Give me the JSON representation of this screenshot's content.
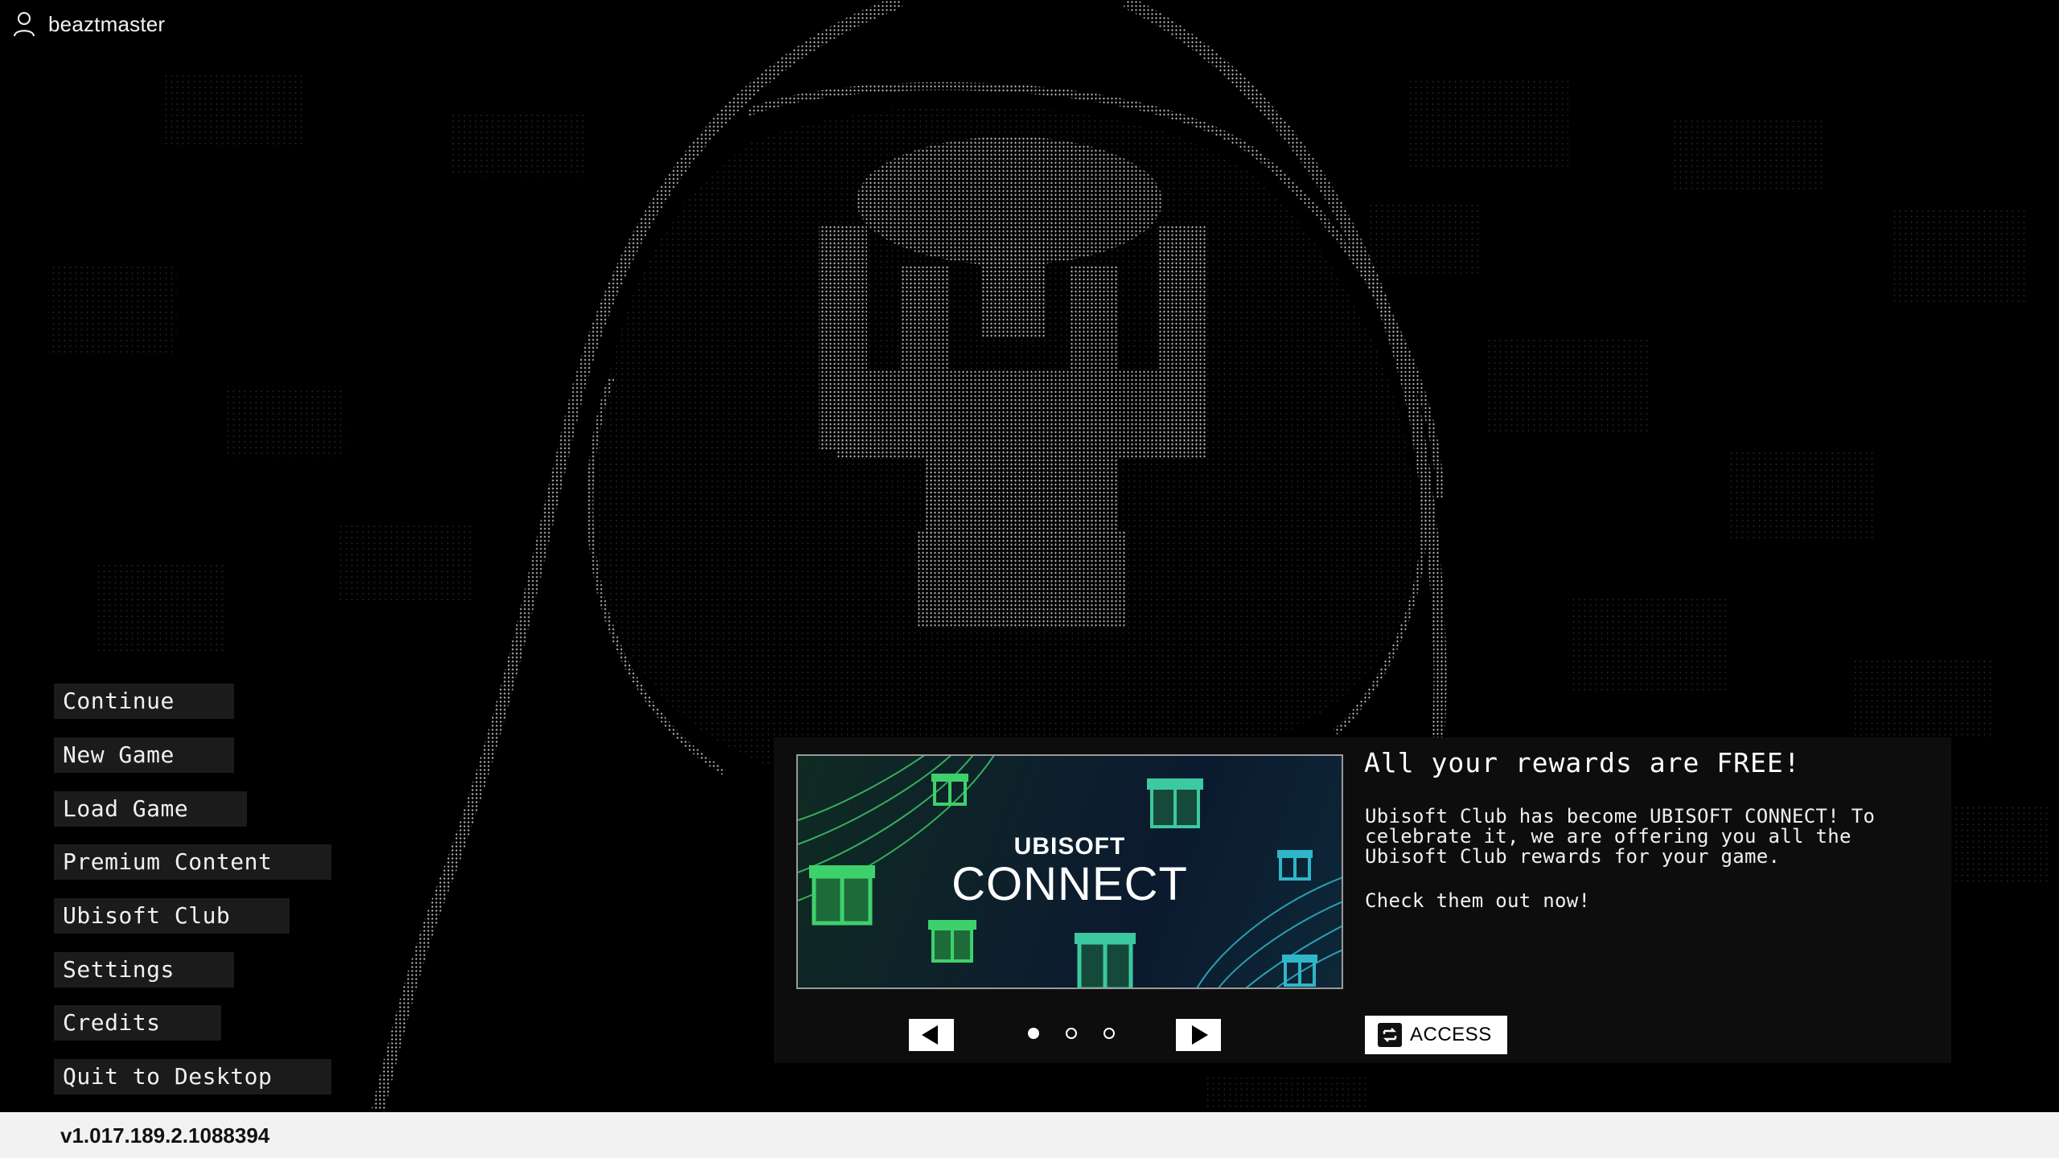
{
  "user": {
    "icon": "user-icon",
    "name": "beaztmaster"
  },
  "menu": {
    "items": [
      {
        "label": "Continue"
      },
      {
        "label": "New Game"
      },
      {
        "label": "Load Game"
      },
      {
        "label": "Premium Content"
      },
      {
        "label": "Ubisoft Club"
      },
      {
        "label": "Settings"
      },
      {
        "label": "Credits"
      },
      {
        "label": "Quit to Desktop"
      }
    ]
  },
  "promo": {
    "image_logo_line1": "UBISOFT",
    "image_logo_line2": "CONNECT",
    "title": "All your rewards are FREE!",
    "body": "Ubisoft Club has become UBISOFT CONNECT! To celebrate it, we are offering you all the Ubisoft Club rewards for your game.",
    "cta": "Check them out now!",
    "prev_icon": "arrow-left-icon",
    "next_icon": "arrow-right-icon",
    "pagination": {
      "total": 3,
      "current": 1
    },
    "access_label": "ACCESS",
    "access_icon": "ubisoft-connect-icon",
    "accent_green": "#3ed16b",
    "accent_teal": "#2fb6c9"
  },
  "footer": {
    "version": "v1.017.189.2.1088394"
  },
  "colors": {
    "background": "#000000",
    "menu_item_bg": "#1b1b1b",
    "panel_bg": "#0d0d0d",
    "version_bar_bg": "#f2f2f2"
  }
}
